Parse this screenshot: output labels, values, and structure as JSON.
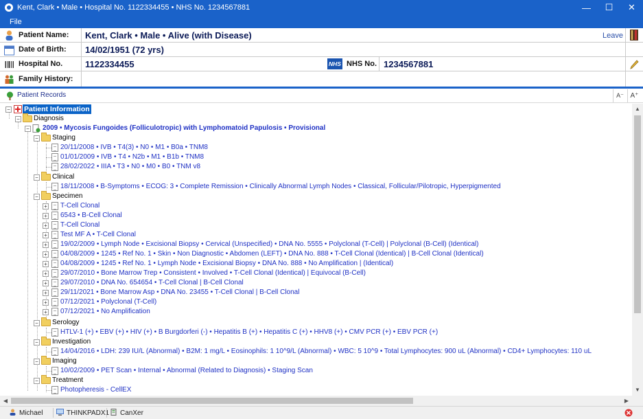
{
  "window": {
    "title": "Kent, Clark • Male • Hospital No. 1122334455 • NHS No. 1234567881",
    "minimize": "—",
    "maximize": "☐",
    "close": "✕"
  },
  "menu": {
    "file": "File"
  },
  "header": {
    "patient_name_label": "Patient Name:",
    "patient_name_value": "Kent, Clark • Male • Alive (with Disease)",
    "dob_label": "Date of Birth:",
    "dob_value": "14/02/1951 (72 yrs)",
    "hospital_label": "Hospital No.",
    "hospital_value": "1122334455",
    "nhs_logo": "NHS",
    "nhs_label": "NHS No.",
    "nhs_value": "1234567881",
    "family_label": "Family History:",
    "family_value": "",
    "leave": "Leave",
    "accent_color": "#1a62c9"
  },
  "records_bar": {
    "label": "Patient Records",
    "font_smaller": "A⁻",
    "font_larger": "A⁺"
  },
  "tree": {
    "root": "Patient Information",
    "diagnosis": "Diagnosis",
    "diagnosis_entry": "2009 • Mycosis Fungoides (Folliculotropic) with Lymphomatoid Papulosis • Provisional",
    "staging": "Staging",
    "staging_items": [
      "20/11/2008 • IVB • T4(3) • N0 • M1 • B0a • TNM8",
      "01/01/2009 • IVB • T4 • N2b • M1 • B1b • TNM8",
      "28/02/2022 • IIIA • T3 • N0 • M0 • B0 • TNM v8"
    ],
    "clinical": "Clinical",
    "clinical_items": [
      "18/11/2008 • B-Symptoms • ECOG: 3 • Complete Remission • Clinically Abnormal Lymph Nodes • Classical, Follicular/Pilotropic, Hyperpigmented"
    ],
    "specimen": "Specimen",
    "specimen_items": [
      "T-Cell Clonal",
      "6543 • B-Cell Clonal",
      "T-Cell Clonal",
      "Test MF A • T-Cell Clonal",
      "19/02/2009 • Lymph Node • Excisional Biopsy • Cervical (Unspecified) • DNA No. 5555 • Polyclonal (T-Cell) | Polyclonal (B-Cell) (Identical)",
      "04/08/2009 • 1245 • Ref No. 1 • Skin • Non Diagnostic • Abdomen (LEFT) • DNA No. 888 • T-Cell Clonal (Identical) | B-Cell Clonal (Identical)",
      "04/08/2009 • 1245 • Ref No. 1 • Lymph Node • Excisional Biopsy • DNA No. 888 • No Amplification | (Identical)",
      "29/07/2010 • Bone Marrow Trep • Consistent • Involved • T-Cell Clonal (Identical) | Equivocal (B-Cell)",
      "29/07/2010 • DNA No. 654654 • T-Cell Clonal | B-Cell Clonal",
      "29/11/2021 • Bone Marrow Asp • DNA No. 23455 • T-Cell Clonal | B-Cell Clonal",
      "07/12/2021 • Polyclonal (T-Cell)",
      "07/12/2021 • No Amplification"
    ],
    "serology": "Serology",
    "serology_items": [
      "HTLV-1 (+) • EBV (+) • HIV (+) • B Burgdorferi (-) • Hepatitis B (+) • Hepatitis C (+) • HHV8 (+) • CMV PCR (+) • EBV PCR (+)"
    ],
    "investigation": "Investigation",
    "investigation_items": [
      "14/04/2016 • LDH: 239 IU/L (Abnormal) • B2M: 1 mg/L • Eosinophils: 1 10^9/L (Abnormal) • WBC: 5 10^9 • Total Lymphocytes: 900 uL (Abnormal) • CD4+ Lymphocytes: 110 uL"
    ],
    "imaging": "Imaging",
    "imaging_items": [
      "10/02/2009 • PET Scan • Internal • Abnormal (Related to Diagnosis) • Staging Scan"
    ],
    "treatment": "Treatment",
    "treatment_items": [
      "Photopheresis - CellEX"
    ]
  },
  "status": {
    "user": "Michael",
    "machine": "THINKPADX1",
    "app": "CanXer"
  }
}
